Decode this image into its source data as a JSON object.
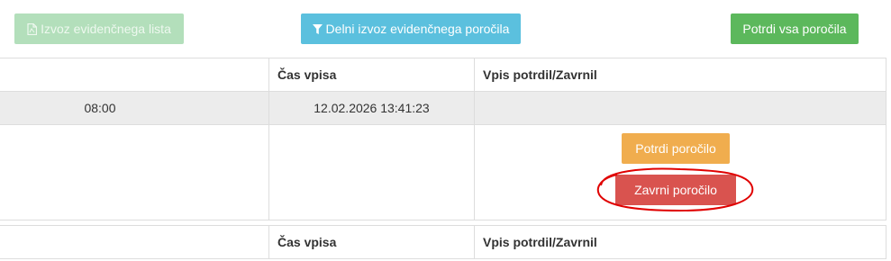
{
  "toolbar": {
    "export_label": "Izvoz evidenčnega lista",
    "partial_export_label": "Delni izvoz evidenčnega poročila",
    "confirm_all_label": "Potrdi vsa poročila"
  },
  "table1": {
    "headers": [
      "",
      "Čas vpisa",
      "Vpis potrdil/Zavrnil"
    ],
    "row": [
      "08:00",
      "12.02.2026 13:41:23",
      ""
    ],
    "actions": {
      "confirm_label": "Potrdi poročilo",
      "reject_label": "Zavrni poročilo"
    }
  },
  "table2": {
    "headers": [
      "",
      "Čas vpisa",
      "Vpis potrdil/Zavrnil"
    ]
  },
  "colors": {
    "success": "#5cb85c",
    "info": "#5bc0de",
    "warning": "#f0ad4e",
    "danger": "#d9534f",
    "annotation": "#e00000"
  },
  "icons": {
    "export": "file-pdf-icon",
    "partial_export": "filter-icon"
  }
}
